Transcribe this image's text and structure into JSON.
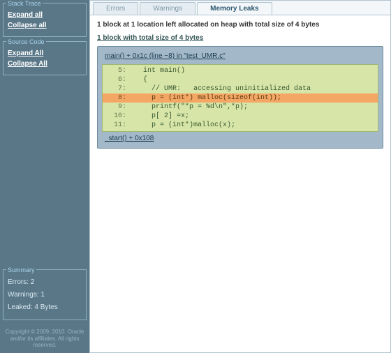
{
  "sidebar": {
    "stack_trace": {
      "title": "Stack Trace",
      "expand": "Expand all",
      "collapse": "Collapse all"
    },
    "source_code": {
      "title": "Source Code",
      "expand": "Expand All",
      "collapse": "Collapse All"
    },
    "summary": {
      "title": "Summary",
      "errors": "Errors: 2",
      "warnings": "Warnings: 1",
      "leaked": "Leaked: 4 Bytes"
    }
  },
  "copyright": "Copyright © 2009, 2010. Oracle and/or its affiliates. All rights reserved.",
  "tabs": {
    "errors": "Errors",
    "warnings": "Warnings",
    "memory": "Memory Leaks"
  },
  "heading": "1 block at 1 location left allocated on heap with total size of 4 bytes",
  "subheading": "1 block with total size of 4 bytes",
  "frame1": "main() + 0x1c (line ~8) in \"test_UMR.c\"",
  "code": {
    "5": "    int main()",
    "6": "    {",
    "7": "      // UMR:   accessing uninitialized data",
    "8": "      p = (int*) malloc(sizeof(int));",
    "9": "      printf(\"*p = %d\\n\",*p);",
    "10": "      p[ 2] =x;",
    "11": "      p = (int*)malloc(x);"
  },
  "frame2": "_start() + 0x108"
}
